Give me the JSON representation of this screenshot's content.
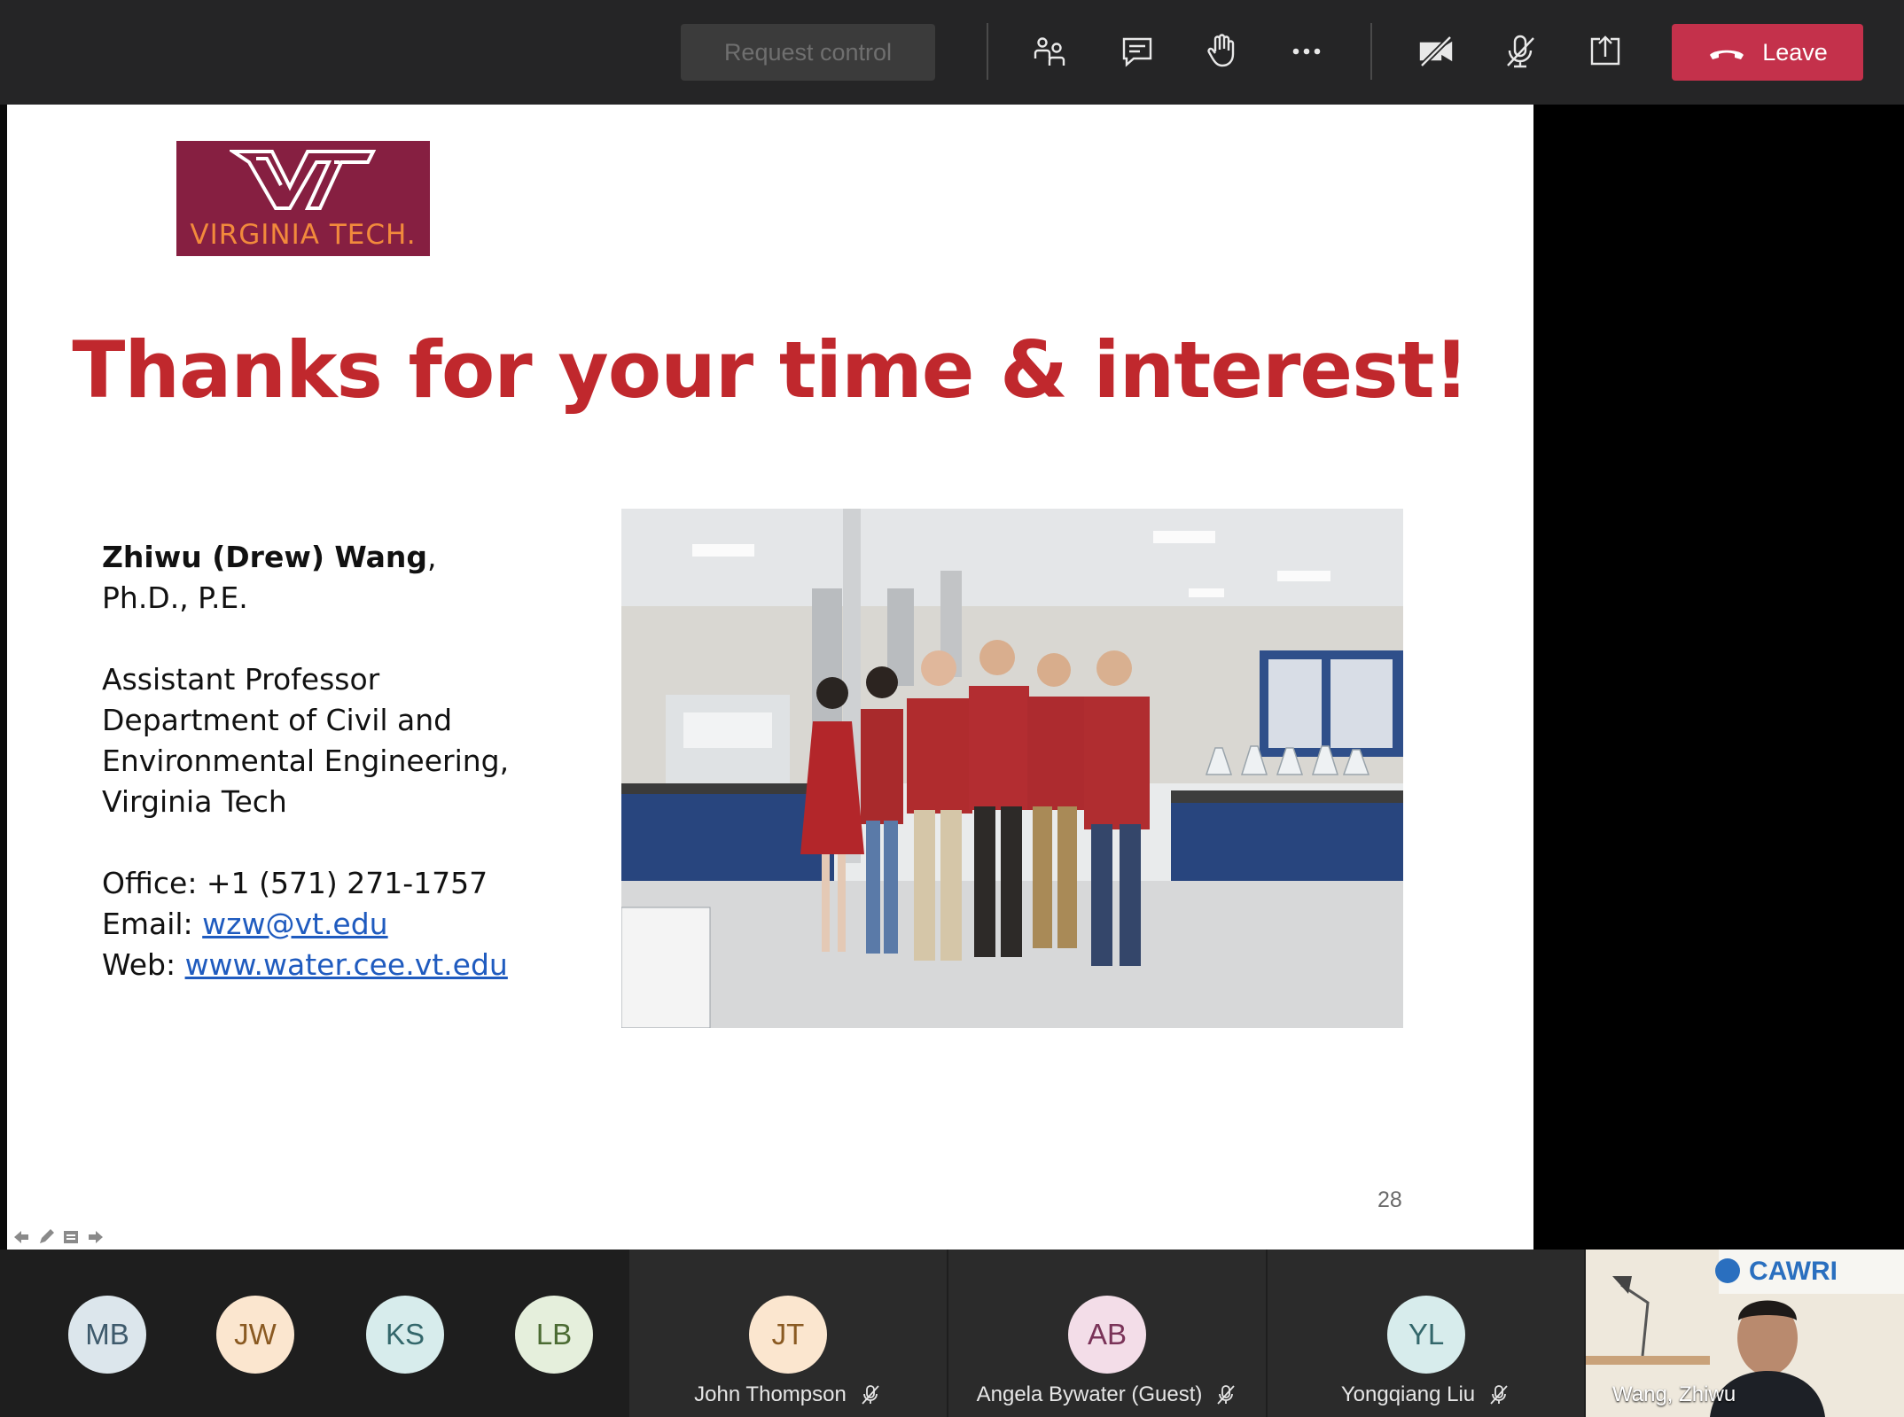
{
  "toolbar": {
    "request_control_label": "Request control",
    "icons": [
      "participants-icon",
      "chat-icon",
      "raise-hand-icon",
      "more-options-icon",
      "camera-off-icon",
      "mic-off-icon",
      "share-screen-icon"
    ],
    "leave_label": "Leave",
    "leave_color": "#c4314b"
  },
  "slide": {
    "logo_text": "VIRGINIA TECH.",
    "title": "Thanks for your time & interest!",
    "title_color": "#c0282d",
    "presenter_name": "Zhiwu (Drew) Wang",
    "presenter_name_suffix": ",",
    "credentials": "Ph.D., P.E.",
    "position": "Assistant Professor",
    "department_line1": "Department of Civil and",
    "department_line2": "Environmental Engineering,",
    "institution": "Virginia Tech",
    "office": "Office: +1 (571) 271-1757",
    "email_label": "Email: ",
    "email": "wzw@vt.edu",
    "web_label": "Web: ",
    "web": "www.water.cee.vt.edu",
    "page_number": "28"
  },
  "participants": [
    {
      "initials": "MB",
      "name": "",
      "bg": "#dce6ec",
      "fg": "#3e5a6c"
    },
    {
      "initials": "JW",
      "name": "",
      "bg": "#fbe6cf",
      "fg": "#8a5a22"
    },
    {
      "initials": "KS",
      "name": "",
      "bg": "#d7ecec",
      "fg": "#33676b"
    },
    {
      "initials": "LB",
      "name": "",
      "bg": "#e5efdc",
      "fg": "#4b6b33"
    },
    {
      "initials": "JT",
      "name": "John Thompson",
      "bg": "#fbe6cf",
      "fg": "#8a5a22"
    },
    {
      "initials": "AB",
      "name": "Angela Bywater (Guest)",
      "bg": "#f3dde8",
      "fg": "#7a3358"
    },
    {
      "initials": "YL",
      "name": "Yongqiang Liu",
      "bg": "#d7ecec",
      "fg": "#33676b"
    }
  ],
  "video": {
    "name": "Wang, Zhiwu",
    "banner": "CAWRI"
  }
}
